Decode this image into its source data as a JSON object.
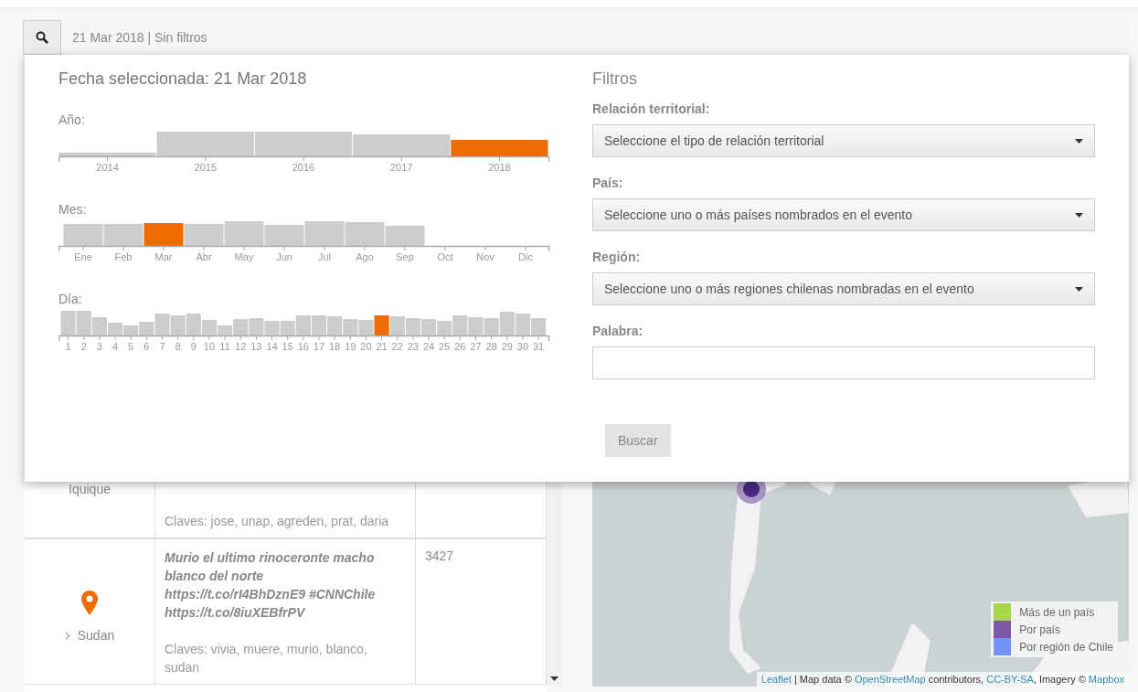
{
  "header": {
    "summary": "21 Mar 2018 | Sin filtros"
  },
  "date_panel": {
    "title": "Fecha seleccionada: 21 Mar 2018",
    "histograms": [
      {
        "kind": "year",
        "label": "Año:",
        "ticks": [
          {
            "label": "2014",
            "selected": false
          },
          {
            "label": "2015",
            "selected": false
          },
          {
            "label": "2016",
            "selected": false
          },
          {
            "label": "2017",
            "selected": false
          },
          {
            "label": "2018",
            "selected": true
          }
        ]
      },
      {
        "kind": "month",
        "label": "Mes:",
        "ticks": [
          {
            "label": "Ene",
            "selected": false
          },
          {
            "label": "Feb",
            "selected": false
          },
          {
            "label": "Mar",
            "selected": true
          },
          {
            "label": "Abr",
            "selected": false
          },
          {
            "label": "May",
            "selected": false
          },
          {
            "label": "Jun",
            "selected": false
          },
          {
            "label": "Jul",
            "selected": false
          },
          {
            "label": "Ago",
            "selected": false
          },
          {
            "label": "Sep",
            "selected": false
          },
          {
            "label": "Oct",
            "selected": false
          },
          {
            "label": "Nov",
            "selected": false
          },
          {
            "label": "Dic",
            "selected": false
          }
        ]
      },
      {
        "kind": "day",
        "label": "Día:",
        "ticks": [
          {
            "label": "1",
            "selected": false
          },
          {
            "label": "2",
            "selected": false
          },
          {
            "label": "3",
            "selected": false
          },
          {
            "label": "4",
            "selected": false
          },
          {
            "label": "5",
            "selected": false
          },
          {
            "label": "6",
            "selected": false
          },
          {
            "label": "7",
            "selected": false
          },
          {
            "label": "8",
            "selected": false
          },
          {
            "label": "9",
            "selected": false
          },
          {
            "label": "10",
            "selected": false
          },
          {
            "label": "11",
            "selected": false
          },
          {
            "label": "12",
            "selected": false
          },
          {
            "label": "13",
            "selected": false
          },
          {
            "label": "14",
            "selected": false
          },
          {
            "label": "15",
            "selected": false
          },
          {
            "label": "16",
            "selected": false
          },
          {
            "label": "17",
            "selected": false
          },
          {
            "label": "18",
            "selected": false
          },
          {
            "label": "19",
            "selected": false
          },
          {
            "label": "20",
            "selected": false
          },
          {
            "label": "21",
            "selected": true
          },
          {
            "label": "22",
            "selected": false
          },
          {
            "label": "23",
            "selected": false
          },
          {
            "label": "24",
            "selected": false
          },
          {
            "label": "25",
            "selected": false
          },
          {
            "label": "26",
            "selected": false
          },
          {
            "label": "27",
            "selected": false
          },
          {
            "label": "28",
            "selected": false
          },
          {
            "label": "29",
            "selected": false
          },
          {
            "label": "30",
            "selected": false
          },
          {
            "label": "31",
            "selected": false
          }
        ]
      }
    ]
  },
  "filters": {
    "title": "Filtros",
    "fields": [
      {
        "kind": "select",
        "label": "Relación territorial:",
        "value": "Seleccione el tipo de relación territorial"
      },
      {
        "kind": "select",
        "label": "País:",
        "value": "Seleccione uno o más países nombrados en el evento"
      },
      {
        "kind": "select",
        "label": "Región:",
        "value": "Seleccione uno o más regiones chilenas nombradas en el evento"
      },
      {
        "kind": "text",
        "label": "Palabra:"
      }
    ],
    "button": {
      "label": "Buscar",
      "disabled": true
    }
  },
  "table": {
    "rows": [
      {
        "has_pin": false,
        "place": "Iquique",
        "expandable": false,
        "keywords": "Claves: jose, unap, agreden, prat, daria"
      },
      {
        "has_pin": true,
        "place": "Sudan",
        "expandable": true,
        "text": [
          "Murio el ultimo rinoceronte macho blanco del norte https://t.co/rI4BhDznE9 #CNNChile https://t.co/8iuXEBfrPV"
        ],
        "keywords": "Claves: vivia, muere, murio, blanco, sudan",
        "count": "3427"
      }
    ]
  },
  "map": {
    "legend": [
      {
        "label": "Más de un país",
        "color": "#a6d84a"
      },
      {
        "label": "Por país",
        "color": "#7b57a8"
      },
      {
        "label": "Por región de Chile",
        "color": "#6f94fb"
      }
    ],
    "attribution": [
      {
        "text": "Leaflet",
        "kind": "link"
      },
      {
        "text": " | Map data © ",
        "kind": "text"
      },
      {
        "text": "OpenStreetMap",
        "kind": "link"
      },
      {
        "text": " contributors, ",
        "kind": "text"
      },
      {
        "text": "CC-BY-SA",
        "kind": "link"
      },
      {
        "text": ", Imagery © ",
        "kind": "text"
      },
      {
        "text": "Mapbox",
        "kind": "link"
      }
    ]
  }
}
